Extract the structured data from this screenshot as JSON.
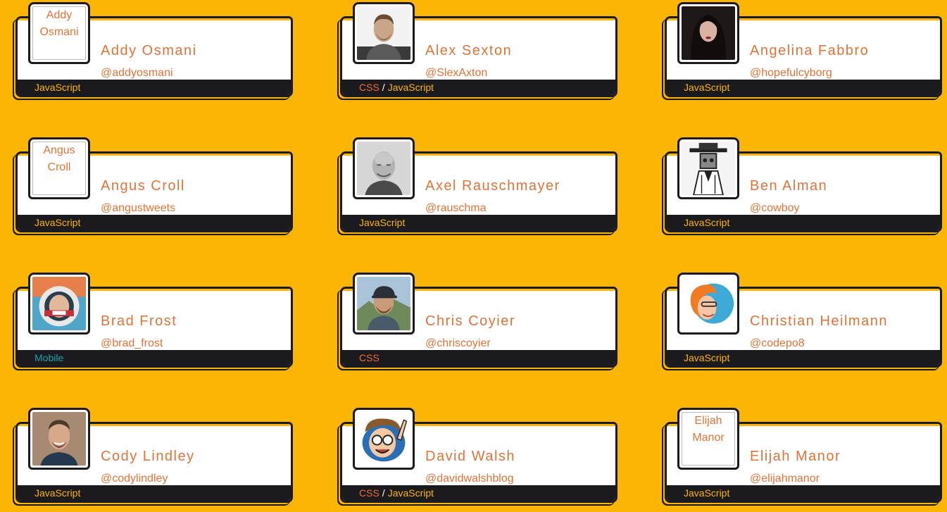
{
  "colors": {
    "background": "#fbb505",
    "card": "#ffffff",
    "border": "#1b1a1e",
    "name_text": "#e0733a",
    "category_javascript": "#fbb505",
    "category_css": "#f46b31",
    "category_mobile": "#1aa3b1",
    "category_separator": "#ffffff"
  },
  "people": [
    {
      "name": "Addy Osmani",
      "handle": "@addyosmani",
      "avatar_alt": "Addy Osmani",
      "avatar_broken": true,
      "categories": [
        "JavaScript"
      ]
    },
    {
      "name": "Alex Sexton",
      "handle": "@SlexAxton",
      "avatar_alt": "",
      "avatar_broken": false,
      "avatar_icon": "photo-man-beard",
      "categories": [
        "CSS",
        "JavaScript"
      ]
    },
    {
      "name": "Angelina Fabbro",
      "handle": "@hopefulcyborg",
      "avatar_alt": "",
      "avatar_broken": false,
      "avatar_icon": "photo-woman-dark",
      "categories": [
        "JavaScript"
      ]
    },
    {
      "name": "Angus Croll",
      "handle": "@angustweets",
      "avatar_alt": "Angus Croll",
      "avatar_broken": true,
      "categories": [
        "JavaScript"
      ]
    },
    {
      "name": "Axel Rauschmayer",
      "handle": "@rauschma",
      "avatar_alt": "",
      "avatar_broken": false,
      "avatar_icon": "photo-man-bald-bw",
      "categories": [
        "JavaScript"
      ]
    },
    {
      "name": "Ben Alman",
      "handle": "@cowboy",
      "avatar_alt": "",
      "avatar_broken": false,
      "avatar_icon": "drawing-robot-cowboy",
      "categories": [
        "JavaScript"
      ]
    },
    {
      "name": "Brad Frost",
      "handle": "@brad_frost",
      "avatar_alt": "",
      "avatar_broken": false,
      "avatar_icon": "photo-astronaut-helmet",
      "categories": [
        "Mobile"
      ]
    },
    {
      "name": "Chris Coyier",
      "handle": "@chriscoyier",
      "avatar_alt": "",
      "avatar_broken": false,
      "avatar_icon": "photo-man-cap-mountains",
      "categories": [
        "CSS"
      ]
    },
    {
      "name": "Christian Heilmann",
      "handle": "@codepo8",
      "avatar_alt": "",
      "avatar_broken": false,
      "avatar_icon": "cartoon-orange-hair",
      "categories": [
        "JavaScript"
      ]
    },
    {
      "name": "Cody Lindley",
      "handle": "@codylindley",
      "avatar_alt": "",
      "avatar_broken": false,
      "avatar_icon": "photo-man-smiling",
      "categories": [
        "JavaScript"
      ]
    },
    {
      "name": "David Walsh",
      "handle": "@davidwalshblog",
      "avatar_alt": "",
      "avatar_broken": false,
      "avatar_icon": "cartoon-glasses-pointing",
      "categories": [
        "CSS",
        "JavaScript"
      ]
    },
    {
      "name": "Elijah Manor",
      "handle": "@elijahmanor",
      "avatar_alt": "Elijah Manor",
      "avatar_broken": true,
      "categories": [
        "JavaScript"
      ]
    }
  ]
}
